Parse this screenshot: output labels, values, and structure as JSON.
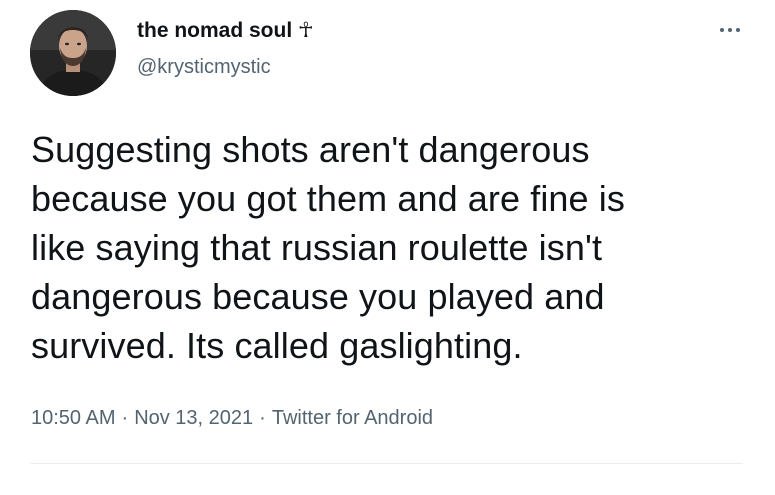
{
  "author": {
    "display_name": "the nomad soul ☥",
    "handle": "@krysticmystic",
    "avatar_icon": "profile-photo"
  },
  "menu": {
    "icon": "more-horizontal-icon"
  },
  "tweet": {
    "text": "Suggesting shots aren't dangerous\nbecause you got them and are fine is\nlike saying that russian roulette isn't\ndangerous because you played and\nsurvived. Its called gaslighting."
  },
  "meta": {
    "time": "10:50 AM",
    "date": "Nov 13, 2021",
    "source": "Twitter for Android",
    "separator": "·"
  },
  "colors": {
    "text": "#0f1419",
    "secondary": "#536471",
    "divider": "#e6ecf0"
  }
}
